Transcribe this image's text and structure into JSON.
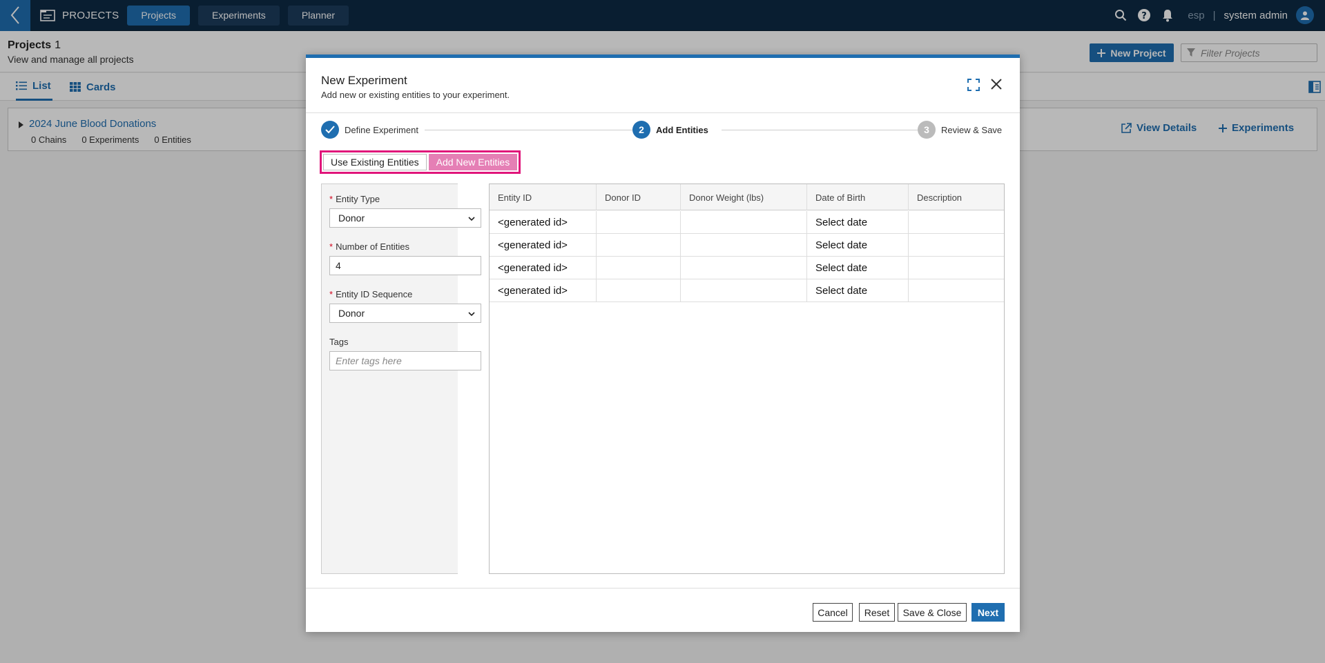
{
  "topbar": {
    "app_title": "PROJECTS",
    "nav": [
      "Projects",
      "Experiments",
      "Planner"
    ],
    "lab": "esp",
    "separator": "|",
    "user": "system admin"
  },
  "page": {
    "title": "Projects",
    "count": "1",
    "subtitle": "View and manage all projects",
    "new_project_label": "New Project",
    "filter_placeholder": "Filter Projects",
    "views": [
      "List",
      "Cards"
    ]
  },
  "project": {
    "name": "2024 June Blood Donations",
    "meta": [
      "0 Chains",
      "0 Experiments",
      "0 Entities"
    ],
    "view_details": "View Details",
    "experiments": "Experiments"
  },
  "modal": {
    "title": "New Experiment",
    "subtitle": "Add new or existing entities to your experiment.",
    "steps": [
      {
        "number": "",
        "label": "Define Experiment",
        "state": "done"
      },
      {
        "number": "2",
        "label": "Add Entities",
        "state": "active"
      },
      {
        "number": "3",
        "label": "Review & Save",
        "state": "todo"
      }
    ],
    "toggle": {
      "existing": "Use Existing Entities",
      "new": "Add New Entities"
    },
    "form": {
      "entity_type_label": "Entity Type",
      "entity_type_value": "Donor",
      "num_entities_label": "Number of Entities",
      "num_entities_value": "4",
      "sequence_label": "Entity ID Sequence",
      "sequence_value": "Donor",
      "tags_label": "Tags",
      "tags_placeholder": "Enter tags here",
      "required_mark": "*"
    },
    "grid": {
      "columns": [
        "Entity ID",
        "Donor ID",
        "Donor Weight (lbs)",
        "Date of Birth",
        "Description"
      ],
      "rows": [
        [
          "<generated id>",
          "",
          "",
          "Select date",
          ""
        ],
        [
          "<generated id>",
          "",
          "",
          "Select date",
          ""
        ],
        [
          "<generated id>",
          "",
          "",
          "Select date",
          ""
        ],
        [
          "<generated id>",
          "",
          "",
          "Select date",
          ""
        ]
      ]
    },
    "buttons": {
      "cancel": "Cancel",
      "reset": "Reset",
      "save_close": "Save & Close",
      "next": "Next"
    }
  },
  "colors": {
    "primary": "#1f6eb0",
    "nav_bg": "#0d2a44",
    "highlight": "#e0157a"
  }
}
